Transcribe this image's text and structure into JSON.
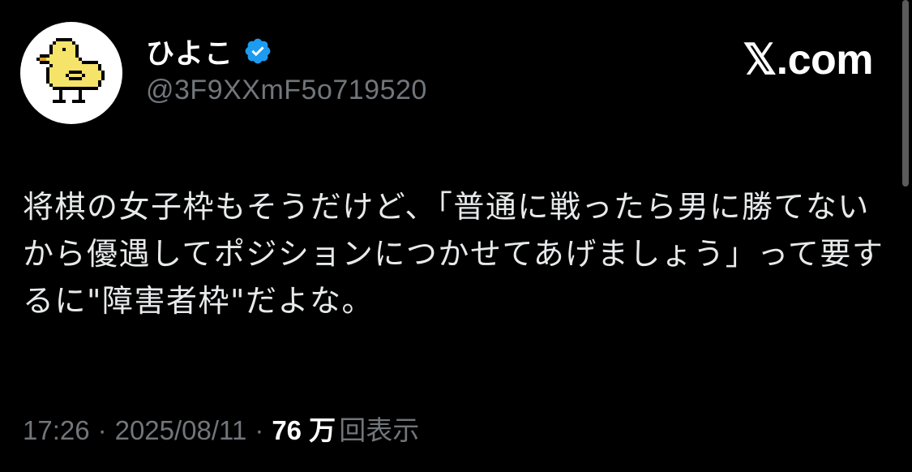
{
  "tweet": {
    "author": {
      "display_name": "ひよこ",
      "handle": "@3F9XXmF5o719520",
      "verified": true,
      "avatar_icon": "pixel-chick-icon"
    },
    "site_brand": "𝕏.com",
    "text": "将棋の女子枠もそうだけど、「普通に戦ったら男に勝てないから優遇してポジションにつかせてあげましょう」って要するに\"障害者枠\"だよな。",
    "meta": {
      "time": "17:26",
      "separator": "·",
      "date": "2025/08/11",
      "views_count": "76 万",
      "views_label": "回表示"
    }
  },
  "colors": {
    "background": "#000000",
    "text_primary": "#e7e9ea",
    "text_secondary": "#71767b",
    "verified_badge": "#1d9bf0",
    "avatar_chick": "#f5e36a"
  }
}
